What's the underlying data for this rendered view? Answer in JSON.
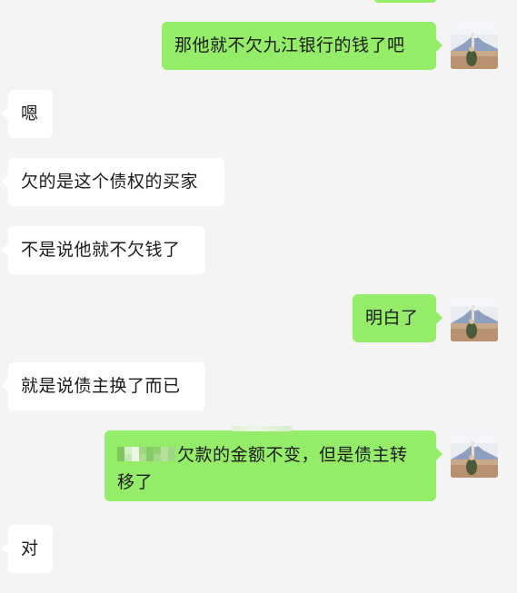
{
  "chat": {
    "messages": [
      {
        "side": "right",
        "text": "那他就不欠九江银行的钱了吧"
      },
      {
        "side": "left",
        "text": "嗯"
      },
      {
        "side": "left",
        "text": "欠的是这个债权的买家"
      },
      {
        "side": "left",
        "text": "不是说他就不欠钱了"
      },
      {
        "side": "right",
        "text": "明白了"
      },
      {
        "side": "left",
        "text": "就是说债主换了而已"
      },
      {
        "side": "right",
        "text_line1": "欠款的金额不变，但是债主转",
        "text_line2": "移了",
        "redacted": true
      },
      {
        "side": "left",
        "text": "对"
      }
    ],
    "avatar": {
      "icon": "mountain-landscape-avatar-icon"
    },
    "colors": {
      "background": "#f4f4f4",
      "sent_bubble": "#95ec69",
      "received_bubble": "#ffffff",
      "text": "#1a1a1a"
    }
  }
}
